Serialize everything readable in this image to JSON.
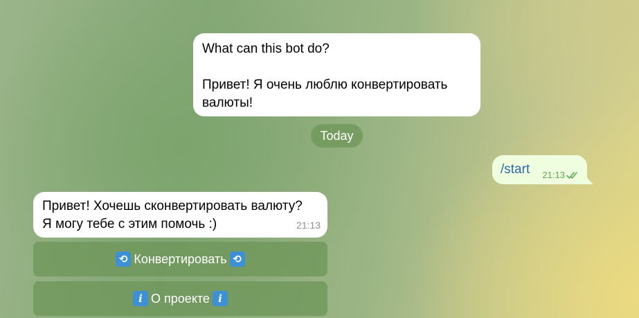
{
  "bot_info": {
    "title": "What can this bot do?",
    "description": "Привет! Я очень люблю конвертировать валюты!"
  },
  "date_separator": "Today",
  "outgoing_message": {
    "text": "/start",
    "time": "21:13",
    "status_icon": "double-check-icon"
  },
  "incoming_message": {
    "text_line1": "Привет! Хочешь сконвертировать валюту?",
    "text_line2": "Я могу тебе с этим помочь :)",
    "time": "21:13"
  },
  "inline_keyboard": {
    "convert_label": "Конвертировать",
    "convert_icon": "repeat-icon",
    "about_label": "О проекте",
    "about_icon": "info-icon"
  },
  "colors": {
    "outgoing_bubble": "#eefedf",
    "check_color": "#5fa85a",
    "command_link": "#2e68a8",
    "emoji_blue": "#3d8fd6"
  }
}
